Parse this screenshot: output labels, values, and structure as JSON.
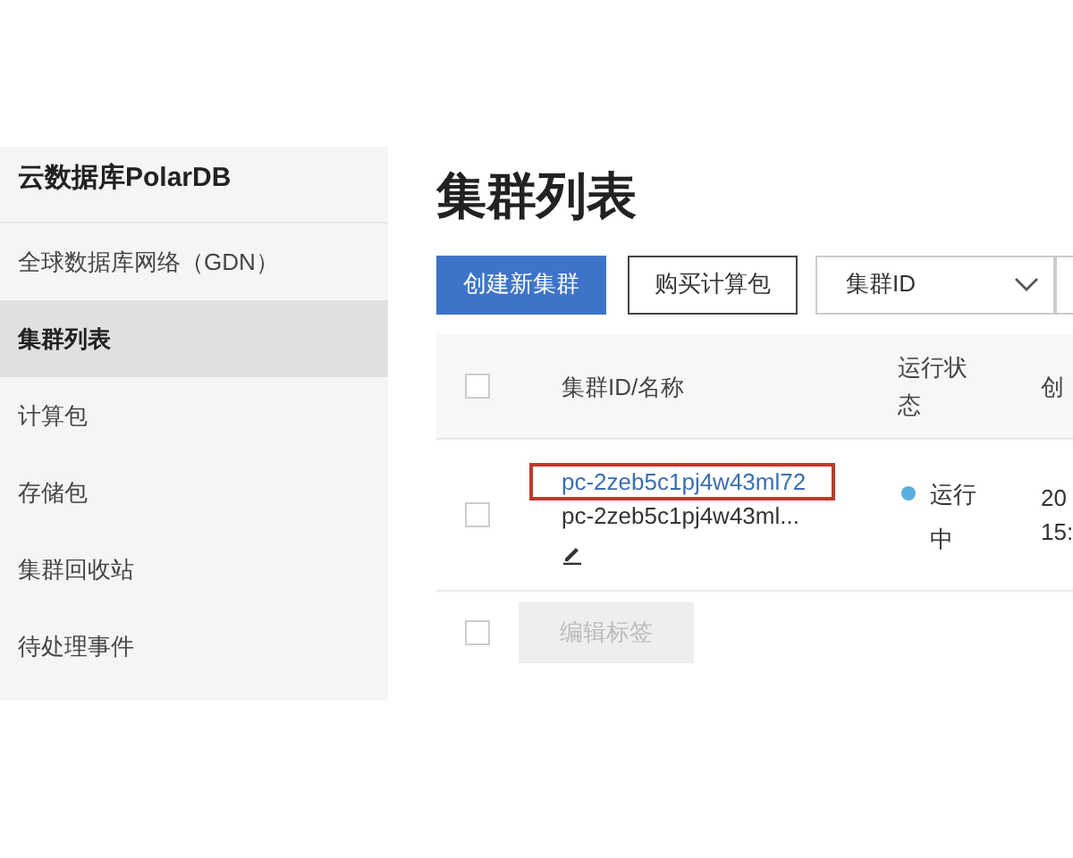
{
  "sidebar": {
    "title": "云数据库PolarDB",
    "items": [
      {
        "label": "全球数据库网络（GDN）",
        "selected": false
      },
      {
        "label": "集群列表",
        "selected": true
      },
      {
        "label": "计算包",
        "selected": false
      },
      {
        "label": "存储包",
        "selected": false
      },
      {
        "label": "集群回收站",
        "selected": false
      },
      {
        "label": "待处理事件",
        "selected": false
      }
    ]
  },
  "page_title": "集群列表",
  "toolbar": {
    "buttons": [
      {
        "label": "创建新集群",
        "kind": "primary"
      },
      {
        "label": "购买计算包",
        "kind": "default"
      }
    ],
    "select": {
      "value": "集群ID"
    }
  },
  "table": {
    "header_checked": false,
    "columns": [
      "集群ID/名称",
      "运行状态",
      "创"
    ],
    "rows": [
      {
        "checked": false,
        "cluster_id": "pc-2zeb5c1pj4w43ml72",
        "highlighted": true,
        "name": "pc-2zeb5c1pj4w43ml...",
        "status": {
          "text": "运行中",
          "color": "#5aaee0"
        },
        "created": [
          "20",
          "15:"
        ]
      }
    ]
  },
  "footer": {
    "checked": false,
    "button": {
      "label": "编辑标签",
      "disabled": true
    }
  }
}
